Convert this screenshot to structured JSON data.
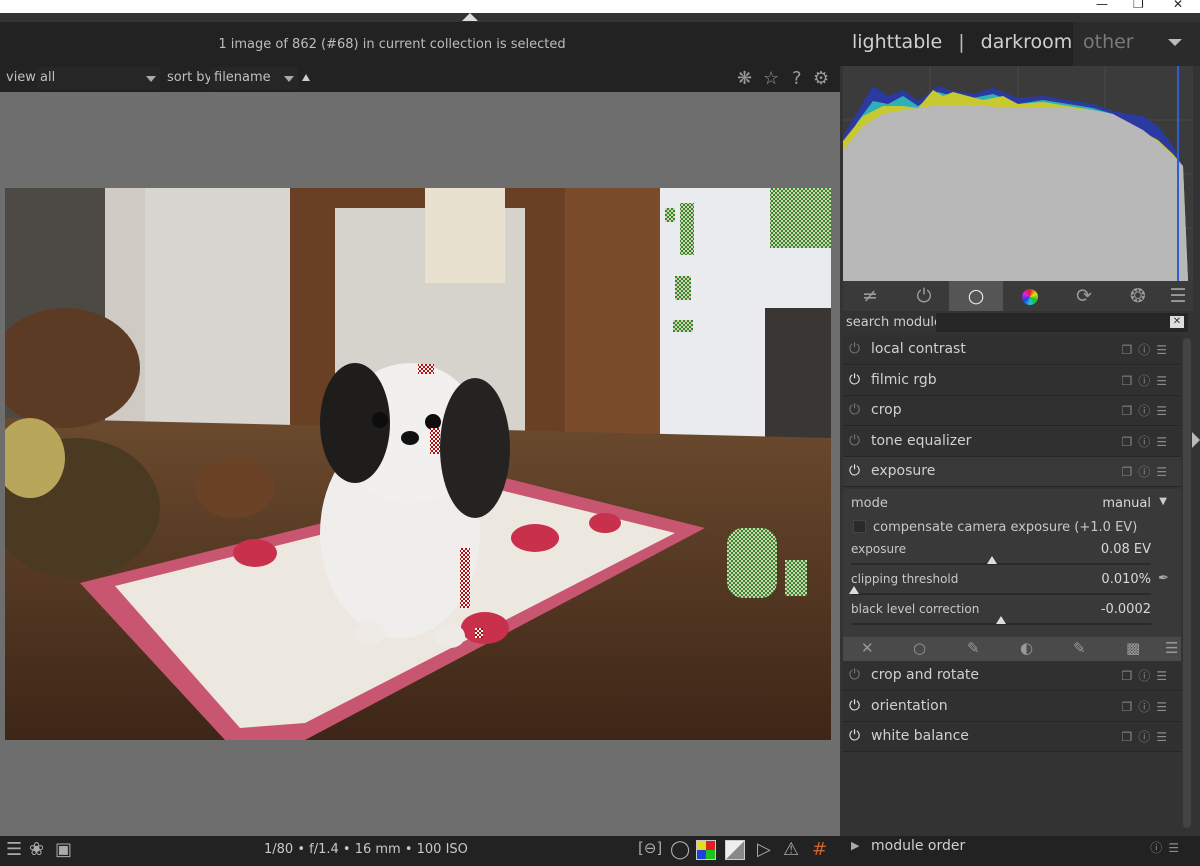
{
  "window": {
    "minimize": "—",
    "restore": "❐",
    "close": "✕"
  },
  "header": {
    "selection_text": "1 image of 862 (#68) in current collection is selected",
    "views": {
      "lighttable": "lighttable",
      "darkroom": "darkroom",
      "other": "other",
      "separator": "|"
    }
  },
  "filterbar": {
    "view_label": "view",
    "view_value": "all",
    "sort_label": "sort by",
    "sort_value": "filename",
    "icons": [
      "presets-icon",
      "star-icon",
      "help-icon",
      "gear-icon"
    ]
  },
  "bottombar": {
    "exif": "1/80 • f/1.4 • 16 mm • 100 ISO",
    "left_icons": [
      "hamburger-icon",
      "styles-icon",
      "display-icon"
    ],
    "right_icons": [
      "focus-peaking-icon",
      "bulb-icon",
      "color-assessment-icon",
      "softproof-icon",
      "gamut-icon",
      "overexposed-warning-icon",
      "grid-guides-icon"
    ]
  },
  "module_groups": [
    "quick-access-icon",
    "active-modules-icon",
    "base-group-icon",
    "color-group-icon",
    "correct-group-icon",
    "effects-group-icon",
    "menu-icon"
  ],
  "search": {
    "label": "search module",
    "value": ""
  },
  "modules_top": [
    {
      "name": "local contrast",
      "enabled": false
    },
    {
      "name": "filmic rgb",
      "enabled": true
    },
    {
      "name": "crop",
      "enabled": false
    },
    {
      "name": "tone equalizer",
      "enabled": false
    },
    {
      "name": "exposure",
      "enabled": true
    }
  ],
  "exposure_module": {
    "mode_label": "mode",
    "mode_value": "manual",
    "compensate_label": "compensate camera exposure (+1.0 EV)",
    "compensate_checked": false,
    "exposure_label": "exposure",
    "exposure_value": "0.08 EV",
    "exposure_level": 0.47,
    "clipping_label": "clipping threshold",
    "clipping_value": "0.010%",
    "clipping_level": 0.01,
    "black_label": "black level correction",
    "black_value": "-0.0002",
    "black_level": 0.5
  },
  "blend_tabs": [
    "off-icon",
    "uniform-icon",
    "drawn-mask-icon",
    "parametric-mask-icon",
    "drawn-parametric-icon",
    "raster-mask-icon",
    "menu-icon"
  ],
  "modules_bottom": [
    {
      "name": "crop and rotate",
      "enabled": false
    },
    {
      "name": "orientation",
      "enabled": true
    },
    {
      "name": "white balance",
      "enabled": true
    }
  ],
  "module_order": {
    "label": "module order"
  },
  "colors": {
    "background": "#333333",
    "panel": "#222222",
    "center": "#6e6e6e",
    "overexposed_warning": "#2e8b2e",
    "underexposed_warning": "#b01010"
  }
}
